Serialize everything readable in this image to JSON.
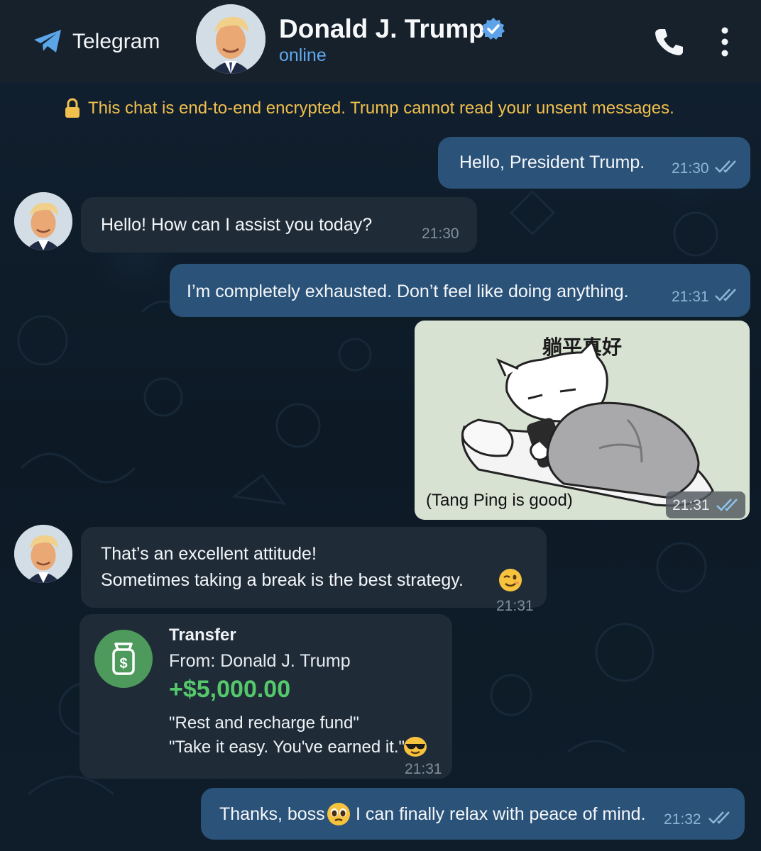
{
  "header": {
    "app_name": "Telegram",
    "contact_name": "Donald J. Trump",
    "status": "online"
  },
  "encryption_notice": "This chat is end-to-end encrypted. Trump cannot read your unsent messages.",
  "messages": [
    {
      "direction": "outgoing",
      "text": "Hello, President Trump.",
      "time": "21:30",
      "read": true
    },
    {
      "direction": "incoming",
      "text": "Hello! How can I assist you today?",
      "time": "21:30"
    },
    {
      "direction": "outgoing",
      "text": "I’m completely exhausted. Don’t feel like doing anything.",
      "time": "21:31",
      "read": true
    },
    {
      "direction": "outgoing",
      "type": "sticker",
      "sticker_title": "躺平真好",
      "caption": "(Tang Ping is good)",
      "time": "21:31",
      "read": true
    },
    {
      "direction": "incoming",
      "lines": [
        "That’s an excellent attitude!",
        "Sometimes taking a break is the best strategy."
      ],
      "emoji": "winking-face",
      "time": "21:31"
    },
    {
      "direction": "incoming",
      "type": "transfer",
      "title": "Transfer",
      "from": "From: Donald J. Trump",
      "amount": "+$5,000.00",
      "memo_line1": "\"Rest and recharge fund\"",
      "memo_line2": "\"Take it easy. You've earned it.\"",
      "emoji": "sunglasses-face",
      "time": "21:31"
    },
    {
      "direction": "outgoing",
      "text_before": "Thanks, boss",
      "emoji": "pleading-face",
      "text_after": "I can finally relax with peace of mind.",
      "time": "21:32",
      "read": true
    }
  ],
  "colors": {
    "outgoing_bubble": "#2b5278",
    "incoming_bubble": "#1f2c38",
    "accent": "#61a8ee",
    "money_green": "#55c86b",
    "notice_yellow": "#f1c04d"
  }
}
